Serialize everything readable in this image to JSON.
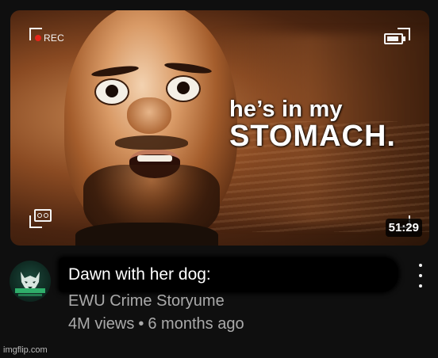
{
  "thumbnail": {
    "overlay_line1": "he’s in my",
    "overlay_line2": "STOMACH.",
    "rec_label": "REC",
    "duration": "51:29",
    "rec_color": "#e5261b",
    "icons": [
      "rec-dot-icon",
      "battery-icon",
      "cassette-tape-icon"
    ]
  },
  "video": {
    "title": "Dawn with her dog:",
    "channel": "EWU Crime Storyume",
    "views": "4M views",
    "separator": "•",
    "age": "6 months ago",
    "menu_icon": "more-vertical-icon"
  },
  "avatar": {
    "label": "EWU CRIME STORYTIME",
    "icon": "wolf-logo-icon"
  },
  "watermark": "imgflip.com",
  "colors": {
    "background": "#0f0f0f",
    "primary_text": "#f1f1f1",
    "secondary_text": "#aaaaaa"
  }
}
